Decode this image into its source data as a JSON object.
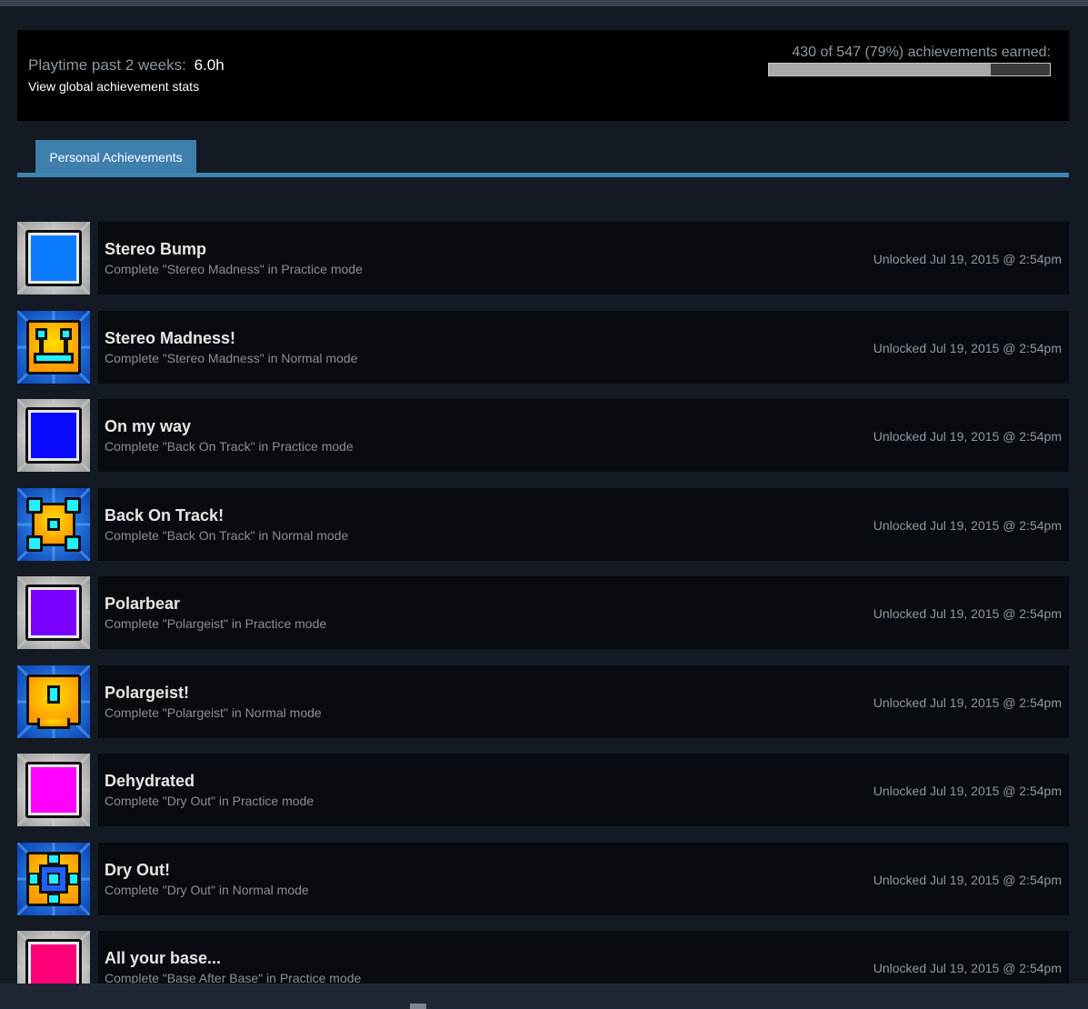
{
  "summary": {
    "playtime_label": "Playtime past 2 weeks:",
    "playtime_value": "6.0h",
    "global_stats_link": "View global achievement stats",
    "earned_text": "430 of 547 (79%) achievements earned:",
    "earned_fraction": 0.79
  },
  "tabs": [
    {
      "label": "Personal Achievements",
      "active": true
    }
  ],
  "achievements": [
    {
      "title": "Stereo Bump",
      "desc": "Complete \"Stereo Madness\" in Practice mode",
      "date": "Unlocked Jul 19, 2015 @ 2:54pm",
      "icon": "practice-cube-icon",
      "color": "#0a7bff"
    },
    {
      "title": "Stereo Madness!",
      "desc": "Complete \"Stereo Madness\" in Normal mode",
      "date": "Unlocked Jul 19, 2015 @ 2:54pm",
      "icon": "normal-cube-face-icon",
      "color": "#ffb400"
    },
    {
      "title": "On my way",
      "desc": "Complete \"Back On Track\" in Practice mode",
      "date": "Unlocked Jul 19, 2015 @ 2:54pm",
      "icon": "practice-cube-icon",
      "color": "#0a0aff"
    },
    {
      "title": "Back On Track!",
      "desc": "Complete \"Back On Track\" in Normal mode",
      "date": "Unlocked Jul 19, 2015 @ 2:54pm",
      "icon": "normal-cube-gear-icon",
      "color": "#ffb400"
    },
    {
      "title": "Polarbear",
      "desc": "Complete \"Polargeist\" in Practice mode",
      "date": "Unlocked Jul 19, 2015 @ 2:54pm",
      "icon": "practice-cube-icon",
      "color": "#7a00ff"
    },
    {
      "title": "Polargeist!",
      "desc": "Complete \"Polargeist\" in Normal mode",
      "date": "Unlocked Jul 19, 2015 @ 2:54pm",
      "icon": "normal-cube-eye-icon",
      "color": "#ffb400"
    },
    {
      "title": "Dehydrated",
      "desc": "Complete \"Dry Out\" in Practice mode",
      "date": "Unlocked Jul 19, 2015 @ 2:54pm",
      "icon": "practice-cube-icon",
      "color": "#ff00ff"
    },
    {
      "title": "Dry Out!",
      "desc": "Complete \"Dry Out\" in Normal mode",
      "date": "Unlocked Jul 19, 2015 @ 2:54pm",
      "icon": "normal-cube-ring-icon",
      "color": "#ffb400"
    },
    {
      "title": "All your base...",
      "desc": "Complete \"Base After Base\" in Practice mode",
      "date": "Unlocked Jul 19, 2015 @ 2:54pm",
      "icon": "practice-cube-icon",
      "color": "#ff0078"
    }
  ]
}
